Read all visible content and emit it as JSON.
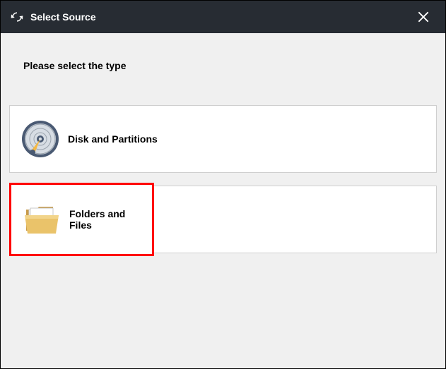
{
  "titlebar": {
    "title": "Select Source"
  },
  "content": {
    "prompt": "Please select the type"
  },
  "options": {
    "disk": {
      "label": "Disk and Partitions"
    },
    "folders": {
      "label": "Folders and Files"
    }
  }
}
